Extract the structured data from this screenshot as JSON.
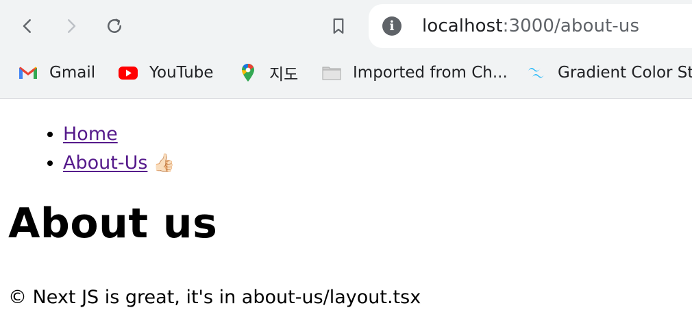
{
  "browser": {
    "url_host": "localhost",
    "url_path": ":3000/about-us",
    "bookmarks": [
      {
        "label": "Gmail",
        "icon": "gmail-icon"
      },
      {
        "label": "YouTube",
        "icon": "youtube-icon"
      },
      {
        "label": "지도",
        "icon": "google-maps-icon"
      },
      {
        "label": "Imported from Ch...",
        "icon": "folder-icon"
      },
      {
        "label": "Gradient Color St",
        "icon": "tailwind-icon"
      }
    ]
  },
  "page": {
    "nav": [
      {
        "label": "Home"
      },
      {
        "label": "About-Us",
        "emoji": "👍🏻"
      }
    ],
    "heading": "About us",
    "footer": "© Next JS is great, it's in about-us/layout.tsx"
  },
  "colors": {
    "chrome_bg": "#f1f3f4",
    "link_visited": "#551a8b"
  }
}
